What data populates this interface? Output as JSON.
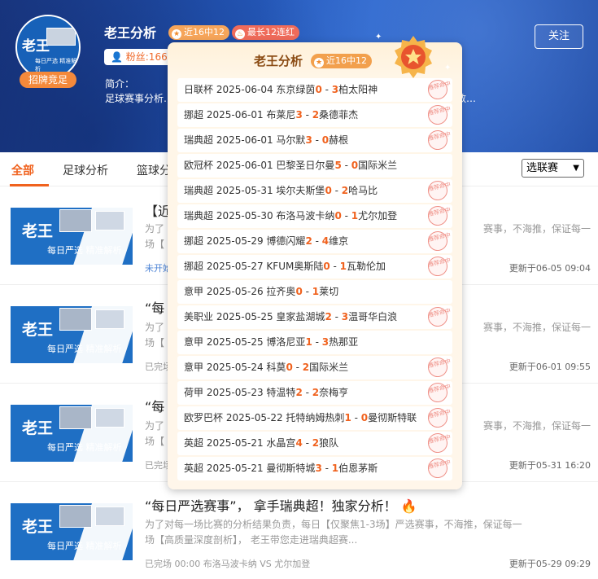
{
  "author": {
    "name": "老王分析",
    "avatar_title": "老王",
    "avatar_sub": "每日严选 精准解析",
    "recruit_badge": "招牌竞足",
    "tag_recent": "近16中12",
    "tag_streak": "最长12连红",
    "fans": "粉丝:166",
    "follow_label": "关注",
    "intro_label": "简介：",
    "intro_text": "足球赛事分析…………………………………………………………本面、消息面及大数…"
  },
  "tabs": [
    "全部",
    "足球分析",
    "篮球分"
  ],
  "league_select": "选联赛",
  "articles": [
    {
      "thumb_title": "老王",
      "thumb_sub": "每日严选  精准解析",
      "title": "【近",
      "summary_left": "为了",
      "summary_right": "赛事，不海推，保证每一",
      "summary_line2": "场【",
      "meta": "未开始",
      "updated": "更新于06-05 09:04"
    },
    {
      "thumb_title": "老王",
      "thumb_sub": "每日严选  精准解析",
      "title": "“每",
      "summary_left": "为了",
      "summary_right": "赛事，不海推，保证每一",
      "summary_line2": "场【",
      "meta": "已完场",
      "updated": "更新于06-01 09:55"
    },
    {
      "thumb_title": "老王",
      "thumb_sub": "每日严选  精准解析",
      "title": "“每",
      "summary_left": "为了",
      "summary_right": "赛事，不海推，保证每一",
      "summary_line2": "场【",
      "meta": "已完场",
      "updated": "更新于05-31 16:20"
    },
    {
      "thumb_title": "老王",
      "thumb_sub": "每日严选  精准解析",
      "title": "“每日严选赛事”， 拿手瑞典超！独家分析！",
      "summary_left": "为了对每一场比赛的分析结果负责，每日【仅聚焦1-3场】严选赛事，不海推，保证每一",
      "summary_right": "",
      "summary_line2": "场【高质量深度剖析】， 老王带您走进瑞典超赛...",
      "meta": "已完场 00:00 布洛马波卡纳 VS 尤尔加登",
      "updated": "更新于05-29 09:29"
    }
  ],
  "popup": {
    "name": "老王分析",
    "tag": "近16中12",
    "stamp_text": "推荐命中",
    "records": [
      {
        "league": "日联杯",
        "date": "2025-06-04",
        "home": "东京绿茵",
        "hs": "0",
        "as": "3",
        "away": "柏太阳神",
        "hit": true
      },
      {
        "league": "挪超",
        "date": "2025-06-01",
        "home": "布莱尼",
        "hs": "3",
        "as": "2",
        "away": "桑德菲杰",
        "hit": true
      },
      {
        "league": "瑞典超",
        "date": "2025-06-01",
        "home": "马尔默",
        "hs": "3",
        "as": "0",
        "away": "赫根",
        "hit": true
      },
      {
        "league": "欧冠杯",
        "date": "2025-06-01",
        "home": "巴黎圣日尔曼",
        "hs": "5",
        "as": "0",
        "away": "国际米兰",
        "hit": false
      },
      {
        "league": "瑞典超",
        "date": "2025-05-31",
        "home": "埃尔夫斯堡",
        "hs": "0",
        "as": "2",
        "away": "哈马比",
        "hit": true
      },
      {
        "league": "瑞典超",
        "date": "2025-05-30",
        "home": "布洛马波卡纳",
        "hs": "0",
        "as": "1",
        "away": "尤尔加登",
        "hit": true
      },
      {
        "league": "挪超",
        "date": "2025-05-29",
        "home": "博德闪耀",
        "hs": "2",
        "as": "4",
        "away": "维京",
        "hit": true
      },
      {
        "league": "挪超",
        "date": "2025-05-27",
        "home": "KFUM奥斯陆",
        "hs": "0",
        "as": "1",
        "away": "瓦勒伦加",
        "hit": true
      },
      {
        "league": "意甲",
        "date": "2025-05-26",
        "home": "拉齐奥",
        "hs": "0",
        "as": "1",
        "away": "莱切",
        "hit": false
      },
      {
        "league": "美职业",
        "date": "2025-05-25",
        "home": "皇家盐湖城",
        "hs": "2",
        "as": "3",
        "away": "温哥华白浪",
        "hit": true
      },
      {
        "league": "意甲",
        "date": "2025-05-25",
        "home": "博洛尼亚",
        "hs": "1",
        "as": "3",
        "away": "热那亚",
        "hit": false
      },
      {
        "league": "意甲",
        "date": "2025-05-24",
        "home": "科莫",
        "hs": "0",
        "as": "2",
        "away": "国际米兰",
        "hit": true
      },
      {
        "league": "荷甲",
        "date": "2025-05-23",
        "home": "特温特",
        "hs": "2",
        "as": "2",
        "away": "奈梅亨",
        "hit": true
      },
      {
        "league": "欧罗巴杯",
        "date": "2025-05-22",
        "home": "托特纳姆热刺",
        "hs": "1",
        "as": "0",
        "away": "曼彻斯特联",
        "hit": true
      },
      {
        "league": "英超",
        "date": "2025-05-21",
        "home": "水晶宫",
        "hs": "4",
        "as": "2",
        "away": "狼队",
        "hit": true
      },
      {
        "league": "英超",
        "date": "2025-05-21",
        "home": "曼彻斯特城",
        "hs": "3",
        "as": "1",
        "away": "伯恩茅斯",
        "hit": true
      }
    ]
  },
  "colors": {
    "accent": "#f0621e",
    "banner": "#2457b8",
    "stamp": "#ef8f86"
  }
}
